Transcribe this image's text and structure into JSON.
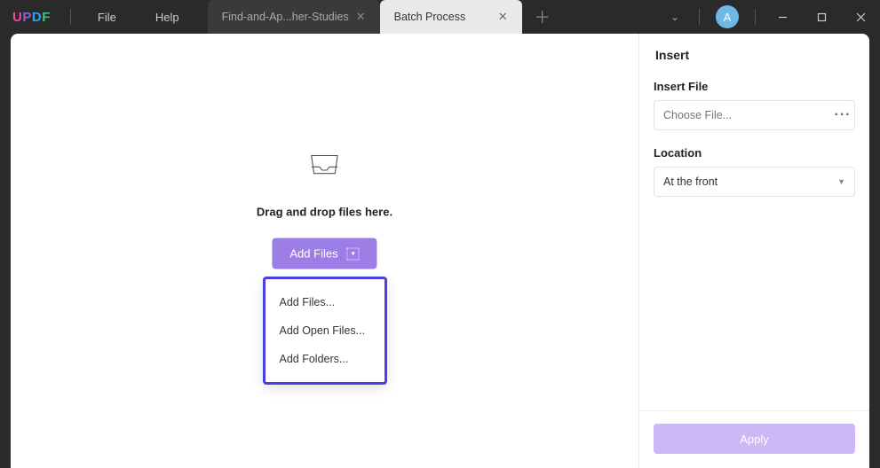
{
  "app": {
    "logo_letters": [
      "U",
      "P",
      "D",
      "F"
    ]
  },
  "menu": {
    "file": "File",
    "help": "Help"
  },
  "tabs": {
    "items": [
      {
        "label": "Find-and-Ap...her-Studies",
        "active": false
      },
      {
        "label": "Batch Process",
        "active": true
      }
    ]
  },
  "titlebar": {
    "avatar_initial": "A"
  },
  "main": {
    "drop_text": "Drag and drop files here.",
    "add_files_btn": "Add Files",
    "dropdown": {
      "add_files": "Add Files...",
      "add_open_files": "Add Open Files...",
      "add_folders": "Add Folders..."
    }
  },
  "sidebar": {
    "title": "Insert",
    "insert_file_label": "Insert File",
    "choose_file_placeholder": "Choose File...",
    "location_label": "Location",
    "location_value": "At the front",
    "apply_label": "Apply"
  }
}
